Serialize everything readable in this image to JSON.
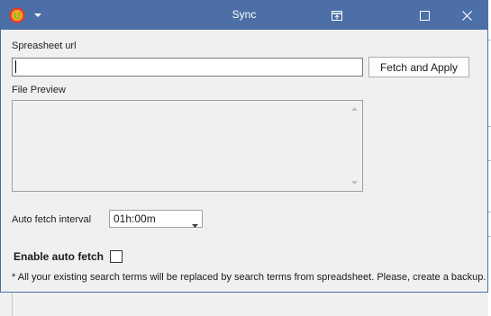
{
  "window": {
    "title": "Sync",
    "logo_letter": "U",
    "icons": {
      "app": "app-logo-icon",
      "system_menu": "chevron-down-icon",
      "restore_tab": "restore-tab-icon",
      "maximize": "maximize-icon",
      "close": "close-icon"
    },
    "colors": {
      "titlebar": "#4b6fa6",
      "window_bg": "#f0f0f0",
      "logo_outer": "#e8372b",
      "logo_inner": "#f5a623",
      "logo_letter": "#7dbb2b"
    }
  },
  "form": {
    "url_label": "Spreasheet url",
    "url_value": "",
    "fetch_button": "Fetch and Apply",
    "preview_label": "File Preview",
    "interval_label": "Auto fetch interval",
    "interval_value": "01h:00m",
    "enable_label": "Enable auto fetch",
    "enable_checked": false,
    "note": "* All your existing search terms will be replaced by search terms from spreadsheet. Please, create a backup."
  }
}
